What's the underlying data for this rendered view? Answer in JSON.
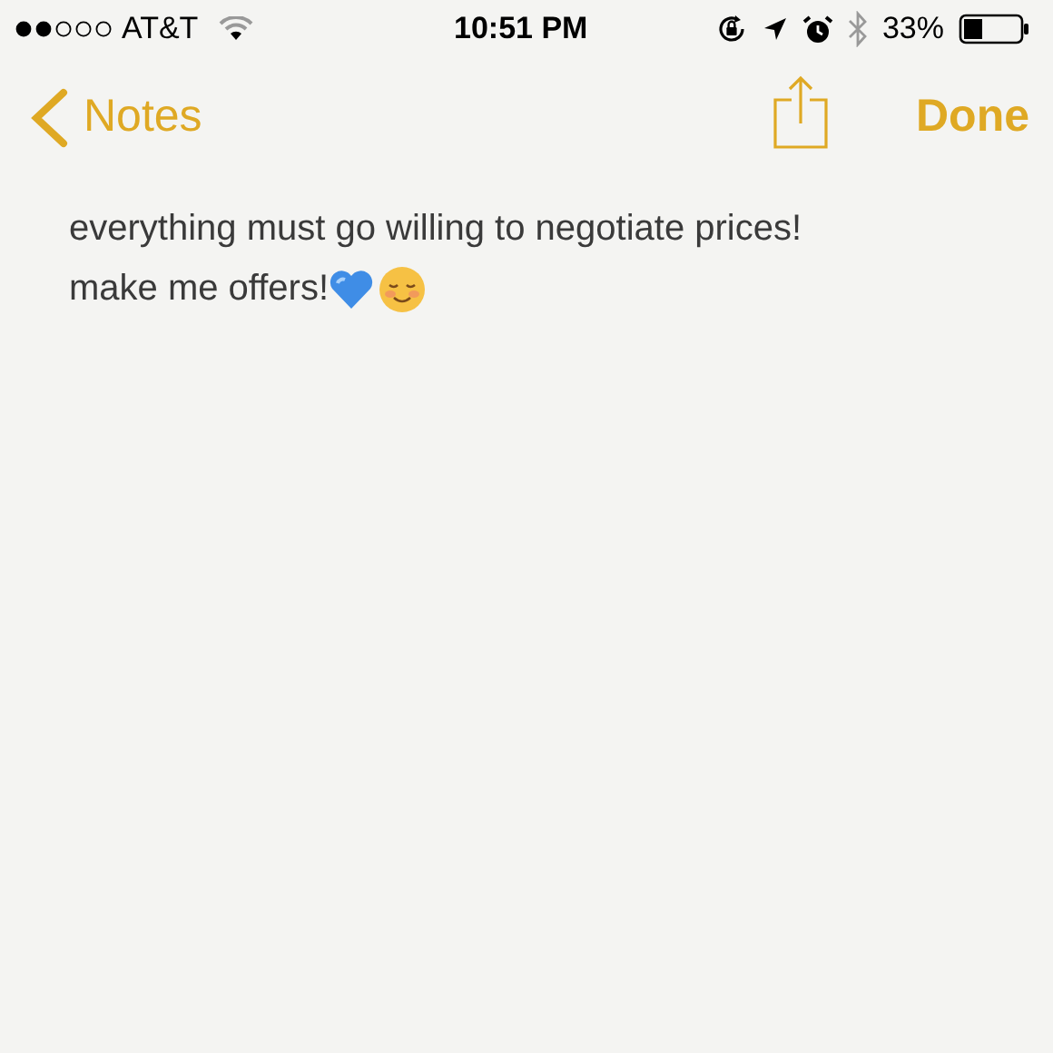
{
  "status_bar": {
    "carrier": "AT&T",
    "time": "10:51 PM",
    "battery_percent": "33%"
  },
  "nav": {
    "back_label": "Notes",
    "done_label": "Done"
  },
  "note": {
    "lines": [
      "everything must go willing to negotiate prices!",
      "make me offers!"
    ]
  }
}
